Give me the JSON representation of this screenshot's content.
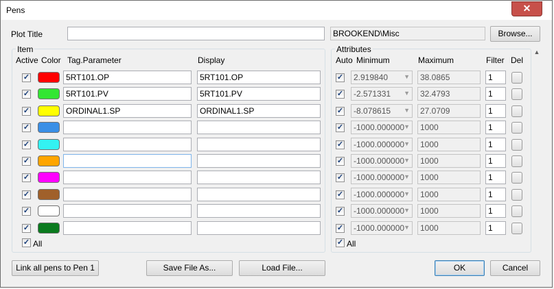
{
  "window": {
    "title": "Pens",
    "close_glyph": "✕"
  },
  "plot": {
    "label": "Plot Title",
    "title_value": "",
    "path_value": "BROOKEND\\Misc",
    "browse_label": "Browse..."
  },
  "item_group": {
    "label": "Item",
    "headers": {
      "active": "Active",
      "color": "Color",
      "tag": "Tag.Parameter",
      "display": "Display"
    },
    "all_label": "All"
  },
  "attr_group": {
    "label": "Attributes",
    "headers": {
      "auto": "Auto",
      "minimum": "Minimum",
      "maximum": "Maximum",
      "filter": "Filter",
      "del": "Del"
    },
    "all_label": "All"
  },
  "check_glyph": "✓",
  "pens": [
    {
      "color": "#ff0000",
      "tag": "5RT101.OP",
      "display": "5RT101.OP",
      "minimum": "2.919840",
      "maximum": "38.0865",
      "filter": "1"
    },
    {
      "color": "#33e633",
      "tag": "5RT101.PV",
      "display": "5RT101.PV",
      "minimum": "-2.571331",
      "maximum": "32.4793",
      "filter": "1"
    },
    {
      "color": "#ffff00",
      "tag": "ORDINAL1.SP",
      "display": "ORDINAL1.SP",
      "minimum": "-8.078615",
      "maximum": "27.0709",
      "filter": "1"
    },
    {
      "color": "#3a8fe6",
      "tag": "",
      "display": "",
      "minimum": "-1000.000000",
      "maximum": "1000",
      "filter": "1"
    },
    {
      "color": "#33f2f2",
      "tag": "",
      "display": "",
      "minimum": "-1000.000000",
      "maximum": "1000",
      "filter": "1"
    },
    {
      "color": "#ffa500",
      "tag": "",
      "display": "",
      "minimum": "-1000.000000",
      "maximum": "1000",
      "filter": "1"
    },
    {
      "color": "#ff00ff",
      "tag": "",
      "display": "",
      "minimum": "-1000.000000",
      "maximum": "1000",
      "filter": "1"
    },
    {
      "color": "#a0602a",
      "tag": "",
      "display": "",
      "minimum": "-1000.000000",
      "maximum": "1000",
      "filter": "1"
    },
    {
      "color": "#ffffff",
      "tag": "",
      "display": "",
      "minimum": "-1000.000000",
      "maximum": "1000",
      "filter": "1"
    },
    {
      "color": "#0a7a1e",
      "tag": "",
      "display": "",
      "minimum": "-1000.000000",
      "maximum": "1000",
      "filter": "1"
    }
  ],
  "buttons": {
    "link": "Link all pens to Pen 1",
    "save": "Save File As...",
    "load": "Load File...",
    "ok": "OK",
    "cancel": "Cancel"
  }
}
